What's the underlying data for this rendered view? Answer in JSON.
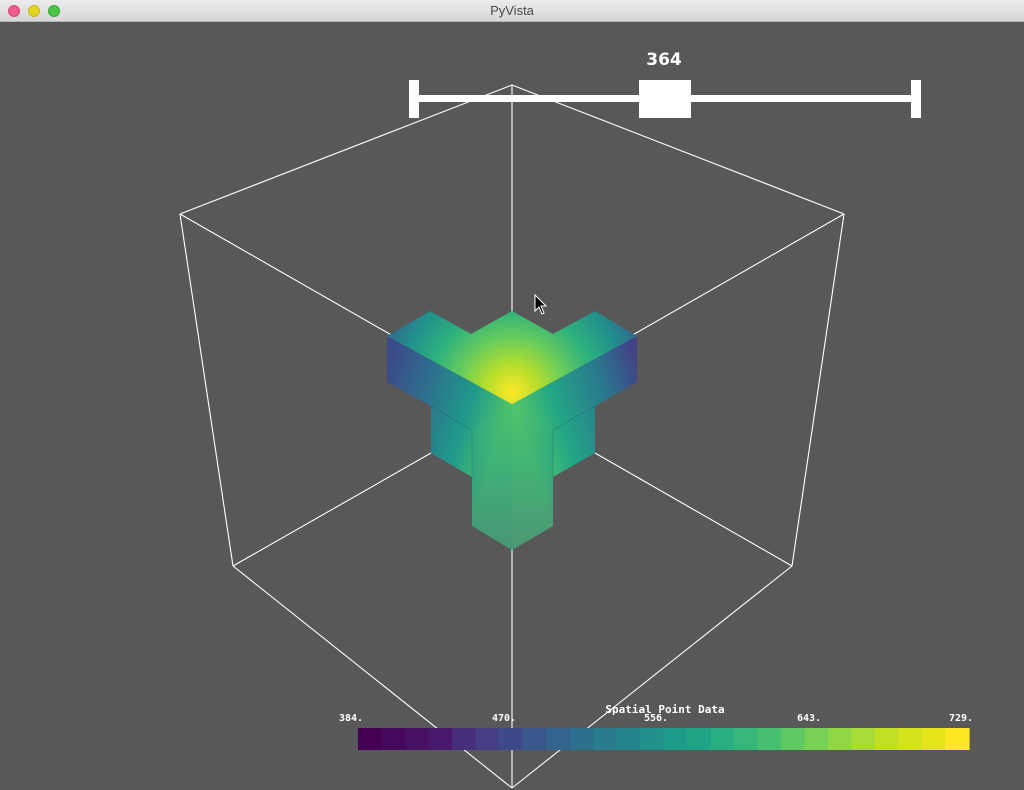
{
  "window": {
    "title": "PyVista"
  },
  "slider": {
    "value": "364"
  },
  "scalar_bar": {
    "title": "Spatial Point Data",
    "labels": [
      "384.",
      "470.",
      "556.",
      "643.",
      "729."
    ],
    "colormap": [
      "#440154",
      "#46085c",
      "#471063",
      "#48186a",
      "#472d7b",
      "#433e85",
      "#3e4989",
      "#38588c",
      "#32648e",
      "#2d708e",
      "#287c8e",
      "#25858e",
      "#21918c",
      "#1e9c89",
      "#20a486",
      "#28ae80",
      "#35b779",
      "#46c06f",
      "#5ec962",
      "#75d054",
      "#8fd744",
      "#a8db34",
      "#c2df23",
      "#d2e21b",
      "#e5e419",
      "#fde725"
    ]
  },
  "colors": {
    "background": "#585858",
    "outline": "#ffffff",
    "slider": "#ffffff"
  }
}
